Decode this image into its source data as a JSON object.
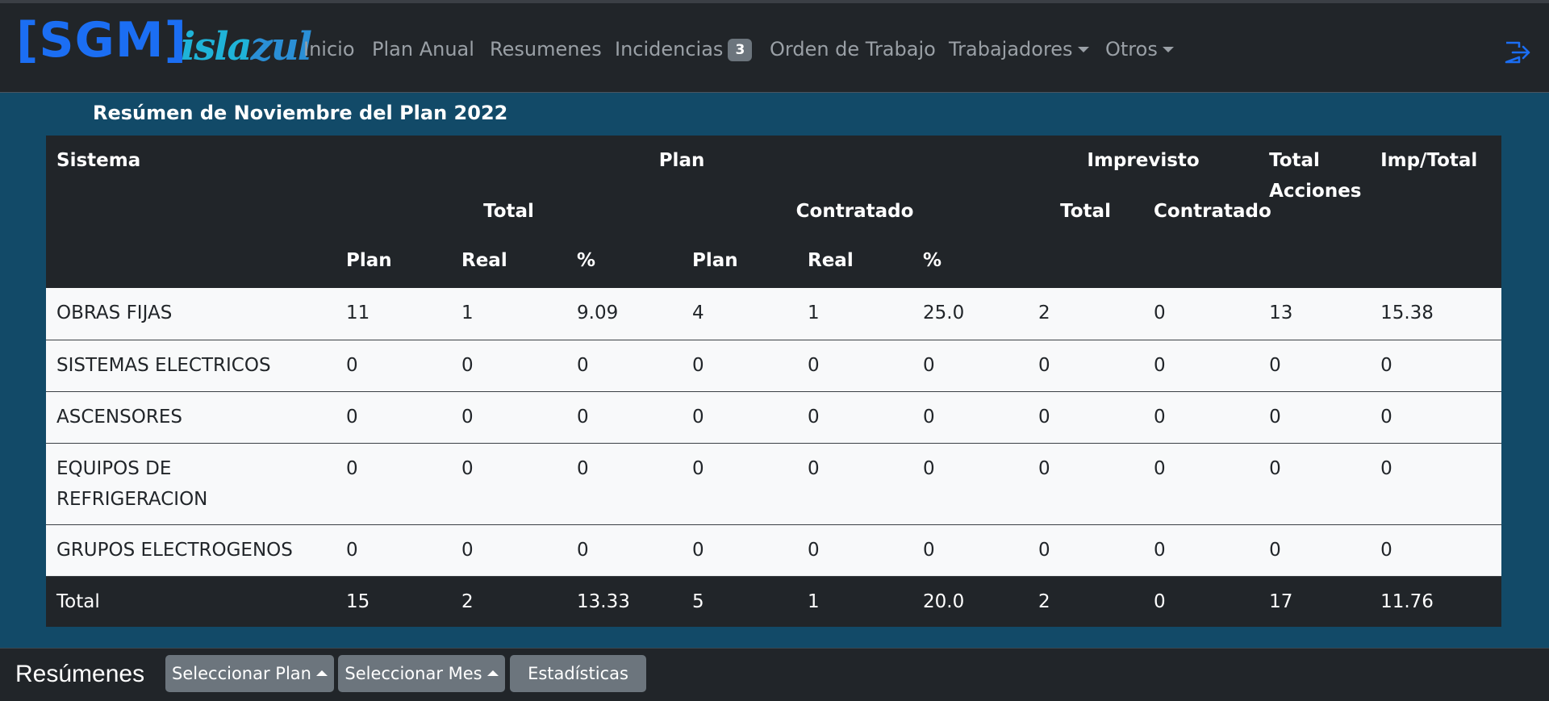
{
  "brand": {
    "name": "[SGM]",
    "logo_parts": [
      "isla",
      "zul"
    ],
    "logo_text": "islazul",
    "color": "#1b6ef3"
  },
  "nav": {
    "items": [
      {
        "label": "Inicio"
      },
      {
        "label": "Plan Anual"
      },
      {
        "label": "Resumenes"
      },
      {
        "label": "Incidencias",
        "badge": "3"
      },
      {
        "label": "Orden de Trabajo"
      },
      {
        "label": "Trabajadores",
        "dropdown": true
      },
      {
        "label": "Otros",
        "dropdown": true
      }
    ],
    "logout_icon": "box-arrow-right-icon"
  },
  "page": {
    "title": "Resúmen de Noviembre del Plan 2022"
  },
  "table": {
    "header_row1": {
      "sistema": "Sistema",
      "plan": "Plan",
      "imprevisto": "Imprevisto",
      "total_acciones": "Total Acciones",
      "imp_total": "Imp/Total"
    },
    "header_row2": {
      "total": "Total",
      "contratado": "Contratado",
      "imp_total": "Total",
      "imp_contratado": "Contratado"
    },
    "header_row3": [
      "Plan",
      "Real",
      "%",
      "Plan",
      "Real",
      "%"
    ],
    "rows": [
      {
        "sistema": "OBRAS FIJAS",
        "values": [
          "11",
          "1",
          "9.09",
          "4",
          "1",
          "25.0",
          "2",
          "0",
          "13",
          "15.38"
        ]
      },
      {
        "sistema": "SISTEMAS ELECTRICOS",
        "values": [
          "0",
          "0",
          "0",
          "0",
          "0",
          "0",
          "0",
          "0",
          "0",
          "0"
        ]
      },
      {
        "sistema": "ASCENSORES",
        "values": [
          "0",
          "0",
          "0",
          "0",
          "0",
          "0",
          "0",
          "0",
          "0",
          "0"
        ]
      },
      {
        "sistema": "EQUIPOS DE REFRIGERACION",
        "values": [
          "0",
          "0",
          "0",
          "0",
          "0",
          "0",
          "0",
          "0",
          "0",
          "0"
        ]
      },
      {
        "sistema": "GRUPOS ELECTROGENOS",
        "values": [
          "0",
          "0",
          "0",
          "0",
          "0",
          "0",
          "0",
          "0",
          "0",
          "0"
        ]
      }
    ],
    "total_row": {
      "label": "Total",
      "values": [
        "15",
        "2",
        "13.33",
        "5",
        "1",
        "20.0",
        "2",
        "0",
        "17",
        "11.76"
      ]
    }
  },
  "footer": {
    "title": "Resúmenes",
    "buttons": [
      {
        "label": "Seleccionar Plan",
        "caret": true
      },
      {
        "label": "Seleccionar Mes",
        "caret": true
      },
      {
        "label": "Estadísticas"
      }
    ]
  },
  "colors": {
    "page_bg": "#124a68",
    "navbar_bg": "#212529",
    "link": "#9aa0a6",
    "brand_blue": "#1b6ef3",
    "button_gray": "#6c757d"
  }
}
